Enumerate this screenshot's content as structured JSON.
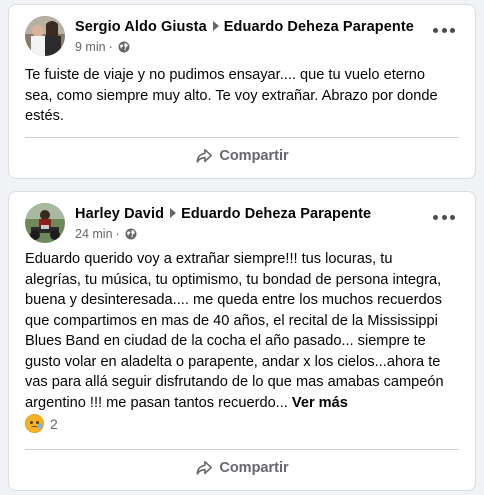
{
  "posts": [
    {
      "author": "Sergio Aldo Giusta",
      "recipient": "Eduardo Deheza Parapente",
      "time": "9 min",
      "separator": "·",
      "privacy_icon": "globe-icon",
      "text": "Te fuiste de viaje y no pudimos ensayar.... que tu vuelo eterno\nsea, como siempre muy alto. Te voy extrañar. Abrazo por donde\nestés.",
      "share_label": "Compartir"
    },
    {
      "author": "Harley David",
      "recipient": "Eduardo Deheza Parapente",
      "time": "24 min",
      "separator": "·",
      "privacy_icon": "globe-icon",
      "text": "Eduardo querido voy a extrañar siempre!!!  tus locuras, tu\nalegrías, tu música, tu optimismo, tu bondad de persona integra,\nbuena y desinteresada.... me queda entre los muchos recuerdos\nque compartimos en mas de 40 años, el recital de la Mississippi\nBlues Band en ciudad de  la cocha el año pasado... siempre te\ngusto volar en aladelta o parapente, andar x los cielos...ahora te\nvas para allá seguir disfrutando de lo que mas amabas campeón\nargentino !!!  me pasan tantos recuerdo... ",
      "see_more": "Ver más",
      "reaction_icon": "sad-reaction-icon",
      "reaction_count": "2",
      "share_label": "Compartir"
    }
  ],
  "colors": {
    "background": "#f0f2f5",
    "card": "#ffffff",
    "secondary_text": "#65676b",
    "primary_text": "#050505"
  }
}
